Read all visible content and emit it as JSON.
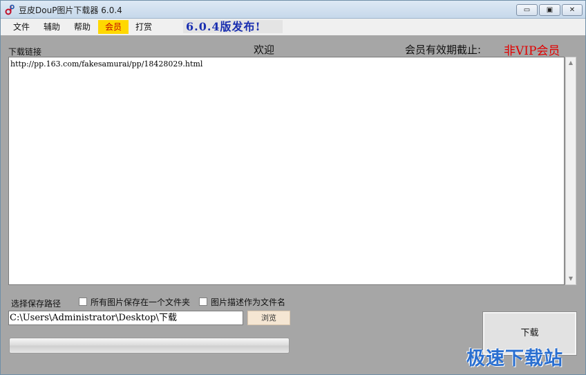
{
  "window": {
    "title": "豆皮DouP图片下载器 6.0.4",
    "controls": {
      "minimize": "▭",
      "maximize": "▣",
      "close": "✕"
    }
  },
  "menu": {
    "items": [
      {
        "label": "文件"
      },
      {
        "label": "辅助"
      },
      {
        "label": "帮助"
      },
      {
        "label": "会员"
      },
      {
        "label": "打赏"
      }
    ],
    "release_notice": "6.0.4版发布!"
  },
  "main": {
    "download_links_label": "下载链接",
    "welcome": "欢迎",
    "membership_label": "会员有效期截止:",
    "membership_status": "非VIP会员",
    "url_text": "http://pp.163.com/fakesamurai/pp/18428029.html",
    "save_path_label": "选择保存路径",
    "option_same_folder": "所有图片保存在一个文件夹",
    "option_same_folder_checked": false,
    "option_desc_filename": "图片描述作为文件名",
    "option_desc_filename_checked": false,
    "save_path_value": "C:\\Users\\Administrator\\Desktop\\下载",
    "browse_label": "浏览",
    "download_label": "下载",
    "progress": 0
  },
  "watermark": "极速下载站",
  "icons": {
    "app": "doup-logo-icon",
    "scroll_up": "scroll-up-arrow-icon",
    "scroll_down": "scroll-down-arrow-icon"
  },
  "colors": {
    "vip_menu_bg": "#ffd800",
    "vip_menu_text": "#c00000",
    "status_red": "#e10000",
    "release_blue": "#1a2fb0",
    "watermark_blue": "#2a6fd0"
  }
}
